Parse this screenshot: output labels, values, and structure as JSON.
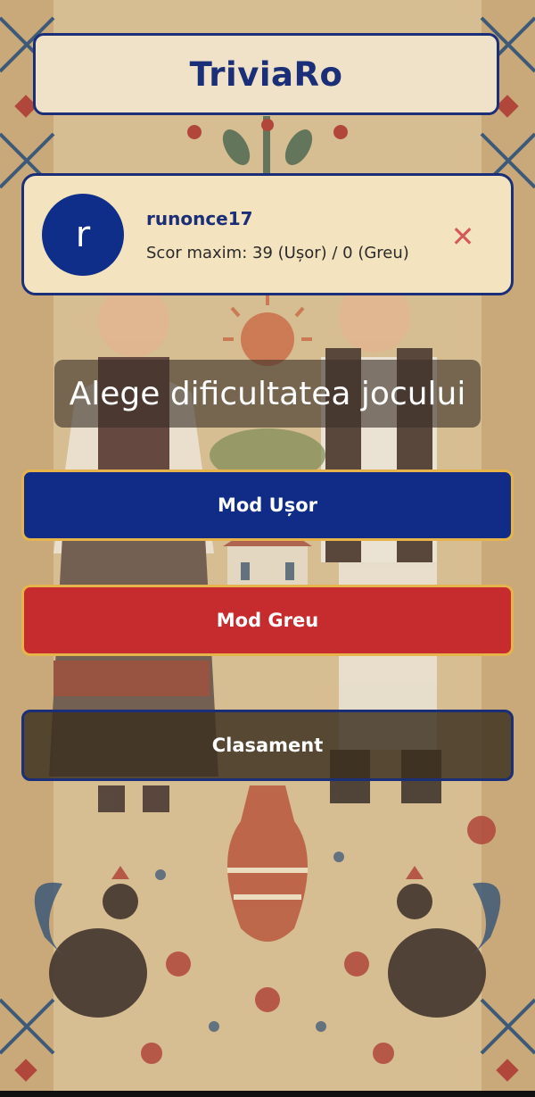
{
  "app": {
    "title": "TriviaRo"
  },
  "profile": {
    "avatar_letter": "r",
    "username": "runonce17",
    "score_text": "Scor maxim: 39 (Ușor) / 0 (Greu)",
    "close_glyph": "✕"
  },
  "main": {
    "heading": "Alege dificultatea jocului",
    "buttons": {
      "easy": "Mod Ușor",
      "hard": "Mod Greu",
      "leaderboard": "Clasament"
    }
  },
  "colors": {
    "brand_blue": "#1b2f78",
    "easy_button": "#102c86",
    "hard_button": "#c62b2e",
    "button_border_gold": "#e6b44a",
    "close_icon": "#d35a5a"
  },
  "icons": [
    "close-icon"
  ]
}
